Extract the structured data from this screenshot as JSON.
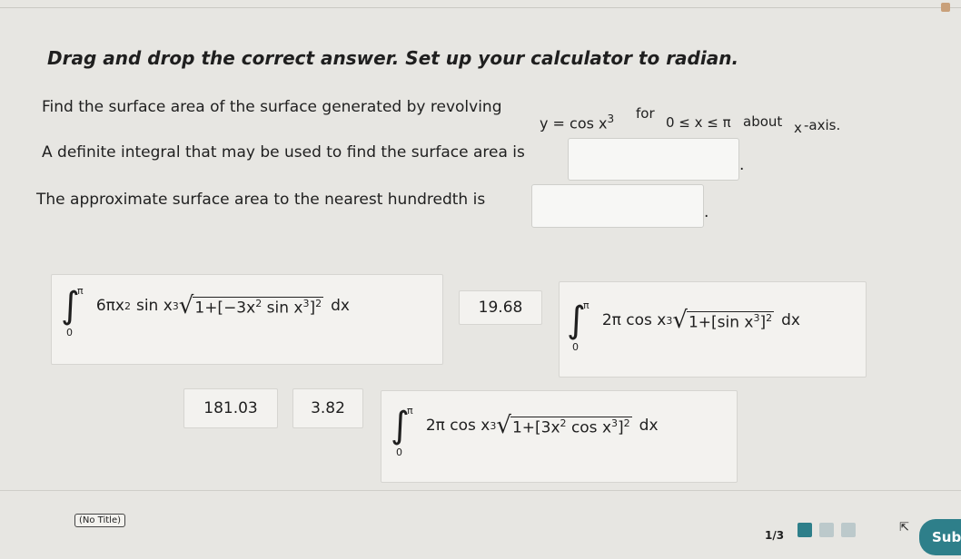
{
  "instruction": "Drag and drop the correct answer. Set up your calculator to radian.",
  "question": {
    "line1_text": "Find the surface area of the surface generated by revolving",
    "function": "y = cos x",
    "function_exp": "3",
    "for_text": "for",
    "interval": "0 ≤ x ≤ π",
    "about_text": "about",
    "axis_var": "x",
    "axis_text": "-axis.",
    "line2_text": "A definite integral that may be used to find the surface area is",
    "line3_text": "The approximate surface area to the nearest hundredth is",
    "period": "."
  },
  "tiles": {
    "integral_a": {
      "upper": "π",
      "lower": "0",
      "coef": "6πx",
      "coef_exp": "2",
      "fn": "sin x",
      "fn_exp": "3",
      "radicand": "1+[−3x",
      "radicand_exp": "2",
      "radicand_mid": "sin x",
      "radicand_mid_exp": "3",
      "radicand_end": "]",
      "radicand_end_exp": "2",
      "dx": "dx"
    },
    "value_1968": "19.68",
    "integral_b": {
      "upper": "π",
      "lower": "0",
      "coef": "2π cos x",
      "coef_exp": "3",
      "radicand": "1+[sin x",
      "radicand_exp": "3",
      "radicand_end": "]",
      "radicand_end_exp": "2",
      "dx": "dx"
    },
    "value_18103": "181.03",
    "value_382": "3.82",
    "integral_c": {
      "upper": "π",
      "lower": "0",
      "coef": "2π cos x",
      "coef_exp": "3",
      "radicand": "1+[3x",
      "radicand_exp": "2",
      "radicand_mid": "cos x",
      "radicand_mid_exp": "3",
      "radicand_end": "]",
      "radicand_end_exp": "2",
      "dx": "dx"
    }
  },
  "footer": {
    "no_title": "(No Title)",
    "page": "1/3",
    "submit": "Subr"
  },
  "colors": {
    "background": "#e7e6e2",
    "tile": "#f3f2ef",
    "submit": "#2e7f8a",
    "progress_done": "#2e7f8a",
    "progress_todo": "#bcc9cb"
  }
}
